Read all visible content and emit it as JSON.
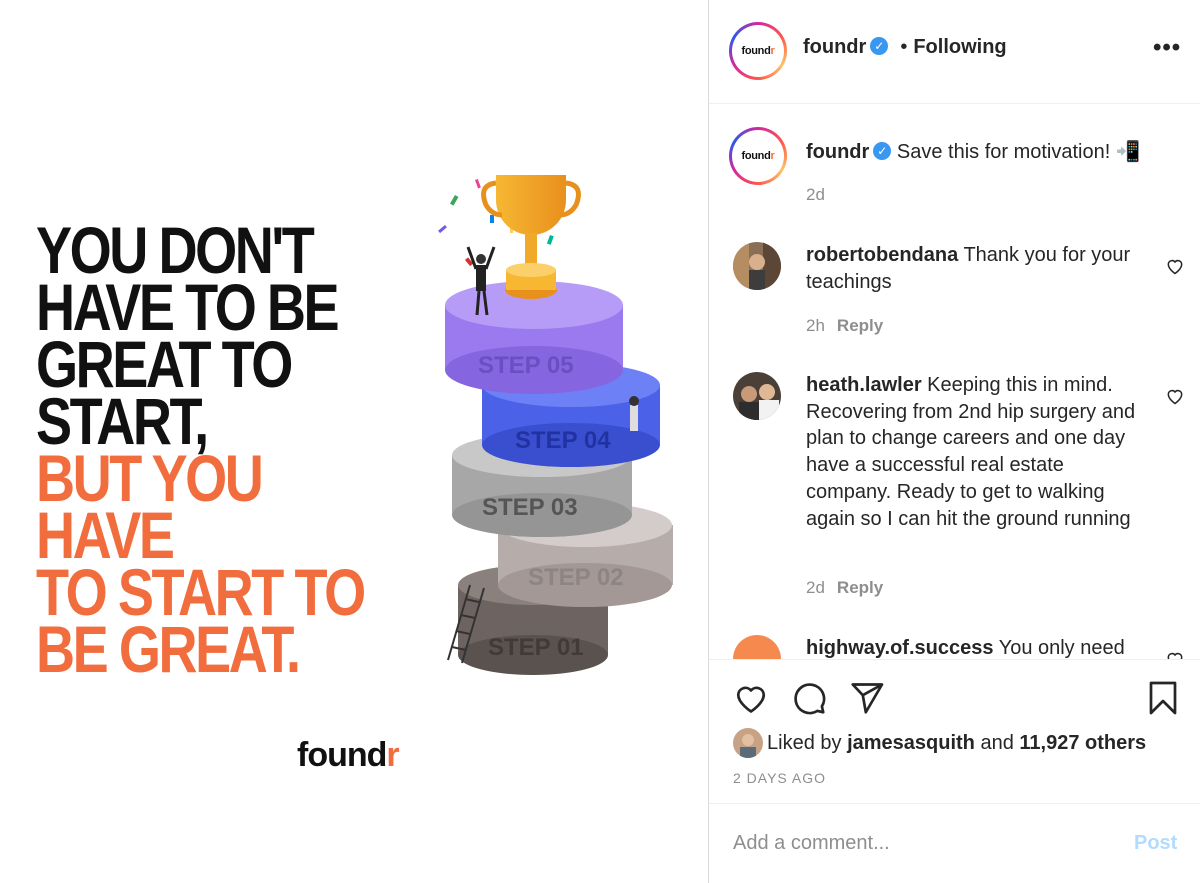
{
  "post_image": {
    "headline_dark": [
      "YOU DON'T",
      "HAVE TO BE",
      "GREAT TO",
      "START,"
    ],
    "headline_orange": [
      "BUT YOU HAVE",
      "TO START TO",
      "BE GREAT."
    ],
    "brand_logo": "found",
    "brand_logo_r": "r",
    "steps": [
      "STEP 05",
      "STEP 04",
      "STEP 03",
      "STEP 02",
      "STEP 01"
    ]
  },
  "header": {
    "avatar_logo": "found",
    "avatar_logo_r": "r",
    "username": "foundr",
    "dot": "•",
    "following_label": "Following",
    "more_label": "•••"
  },
  "caption": {
    "username": "foundr",
    "text": "Save this for motivation! 📲",
    "time": "2d"
  },
  "comments": [
    {
      "username": "robertobendana",
      "text": "Thank you for your teachings",
      "time": "2h",
      "reply_label": "Reply"
    },
    {
      "username": "heath.lawler",
      "text": "Keeping this in mind. Recovering from 2nd hip surgery and plan to change careers and one day have a successful real estate company. Ready to get to walking again so I can hit the ground running",
      "time": "2d",
      "reply_label": "Reply"
    },
    {
      "username": "highway.of.success",
      "text": "You only need"
    }
  ],
  "likes": {
    "prefix": "Liked by",
    "user": "jamesasquith",
    "middle": "and",
    "others": "11,927 others"
  },
  "post_date": "2 DAYS AGO",
  "comment_box": {
    "placeholder": "Add a comment...",
    "post_label": "Post"
  },
  "colors": {
    "accent_orange": "#f26d3d",
    "verified_blue": "#3897f0",
    "post_button_disabled": "#b3dbff"
  }
}
